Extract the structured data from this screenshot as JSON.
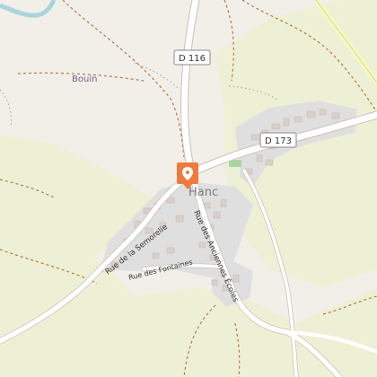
{
  "map": {
    "place_label": "Hanc",
    "locality_label": "Bouin",
    "marker_icon": "location-pin-icon",
    "roads": {
      "d116": "D 116",
      "d173": "D 173",
      "semorelie": "Rue de la Semorelie",
      "fontaines": "Rue des Fontaines",
      "anciennes_ecoles": "Rue des Anciennes Écoles"
    },
    "colors": {
      "background": "#f2efe9",
      "fields": "#eef0d5",
      "built_area": "#e0dfdf",
      "buildings": "#d9d0c9",
      "road": "#ffffff",
      "track": "#b07a3f",
      "river": "#aad3df",
      "rail": "#f7fabf",
      "marker": "#f07a3c",
      "place_label": "#7b7b7b",
      "locality_label": "#7a5a8a"
    }
  }
}
